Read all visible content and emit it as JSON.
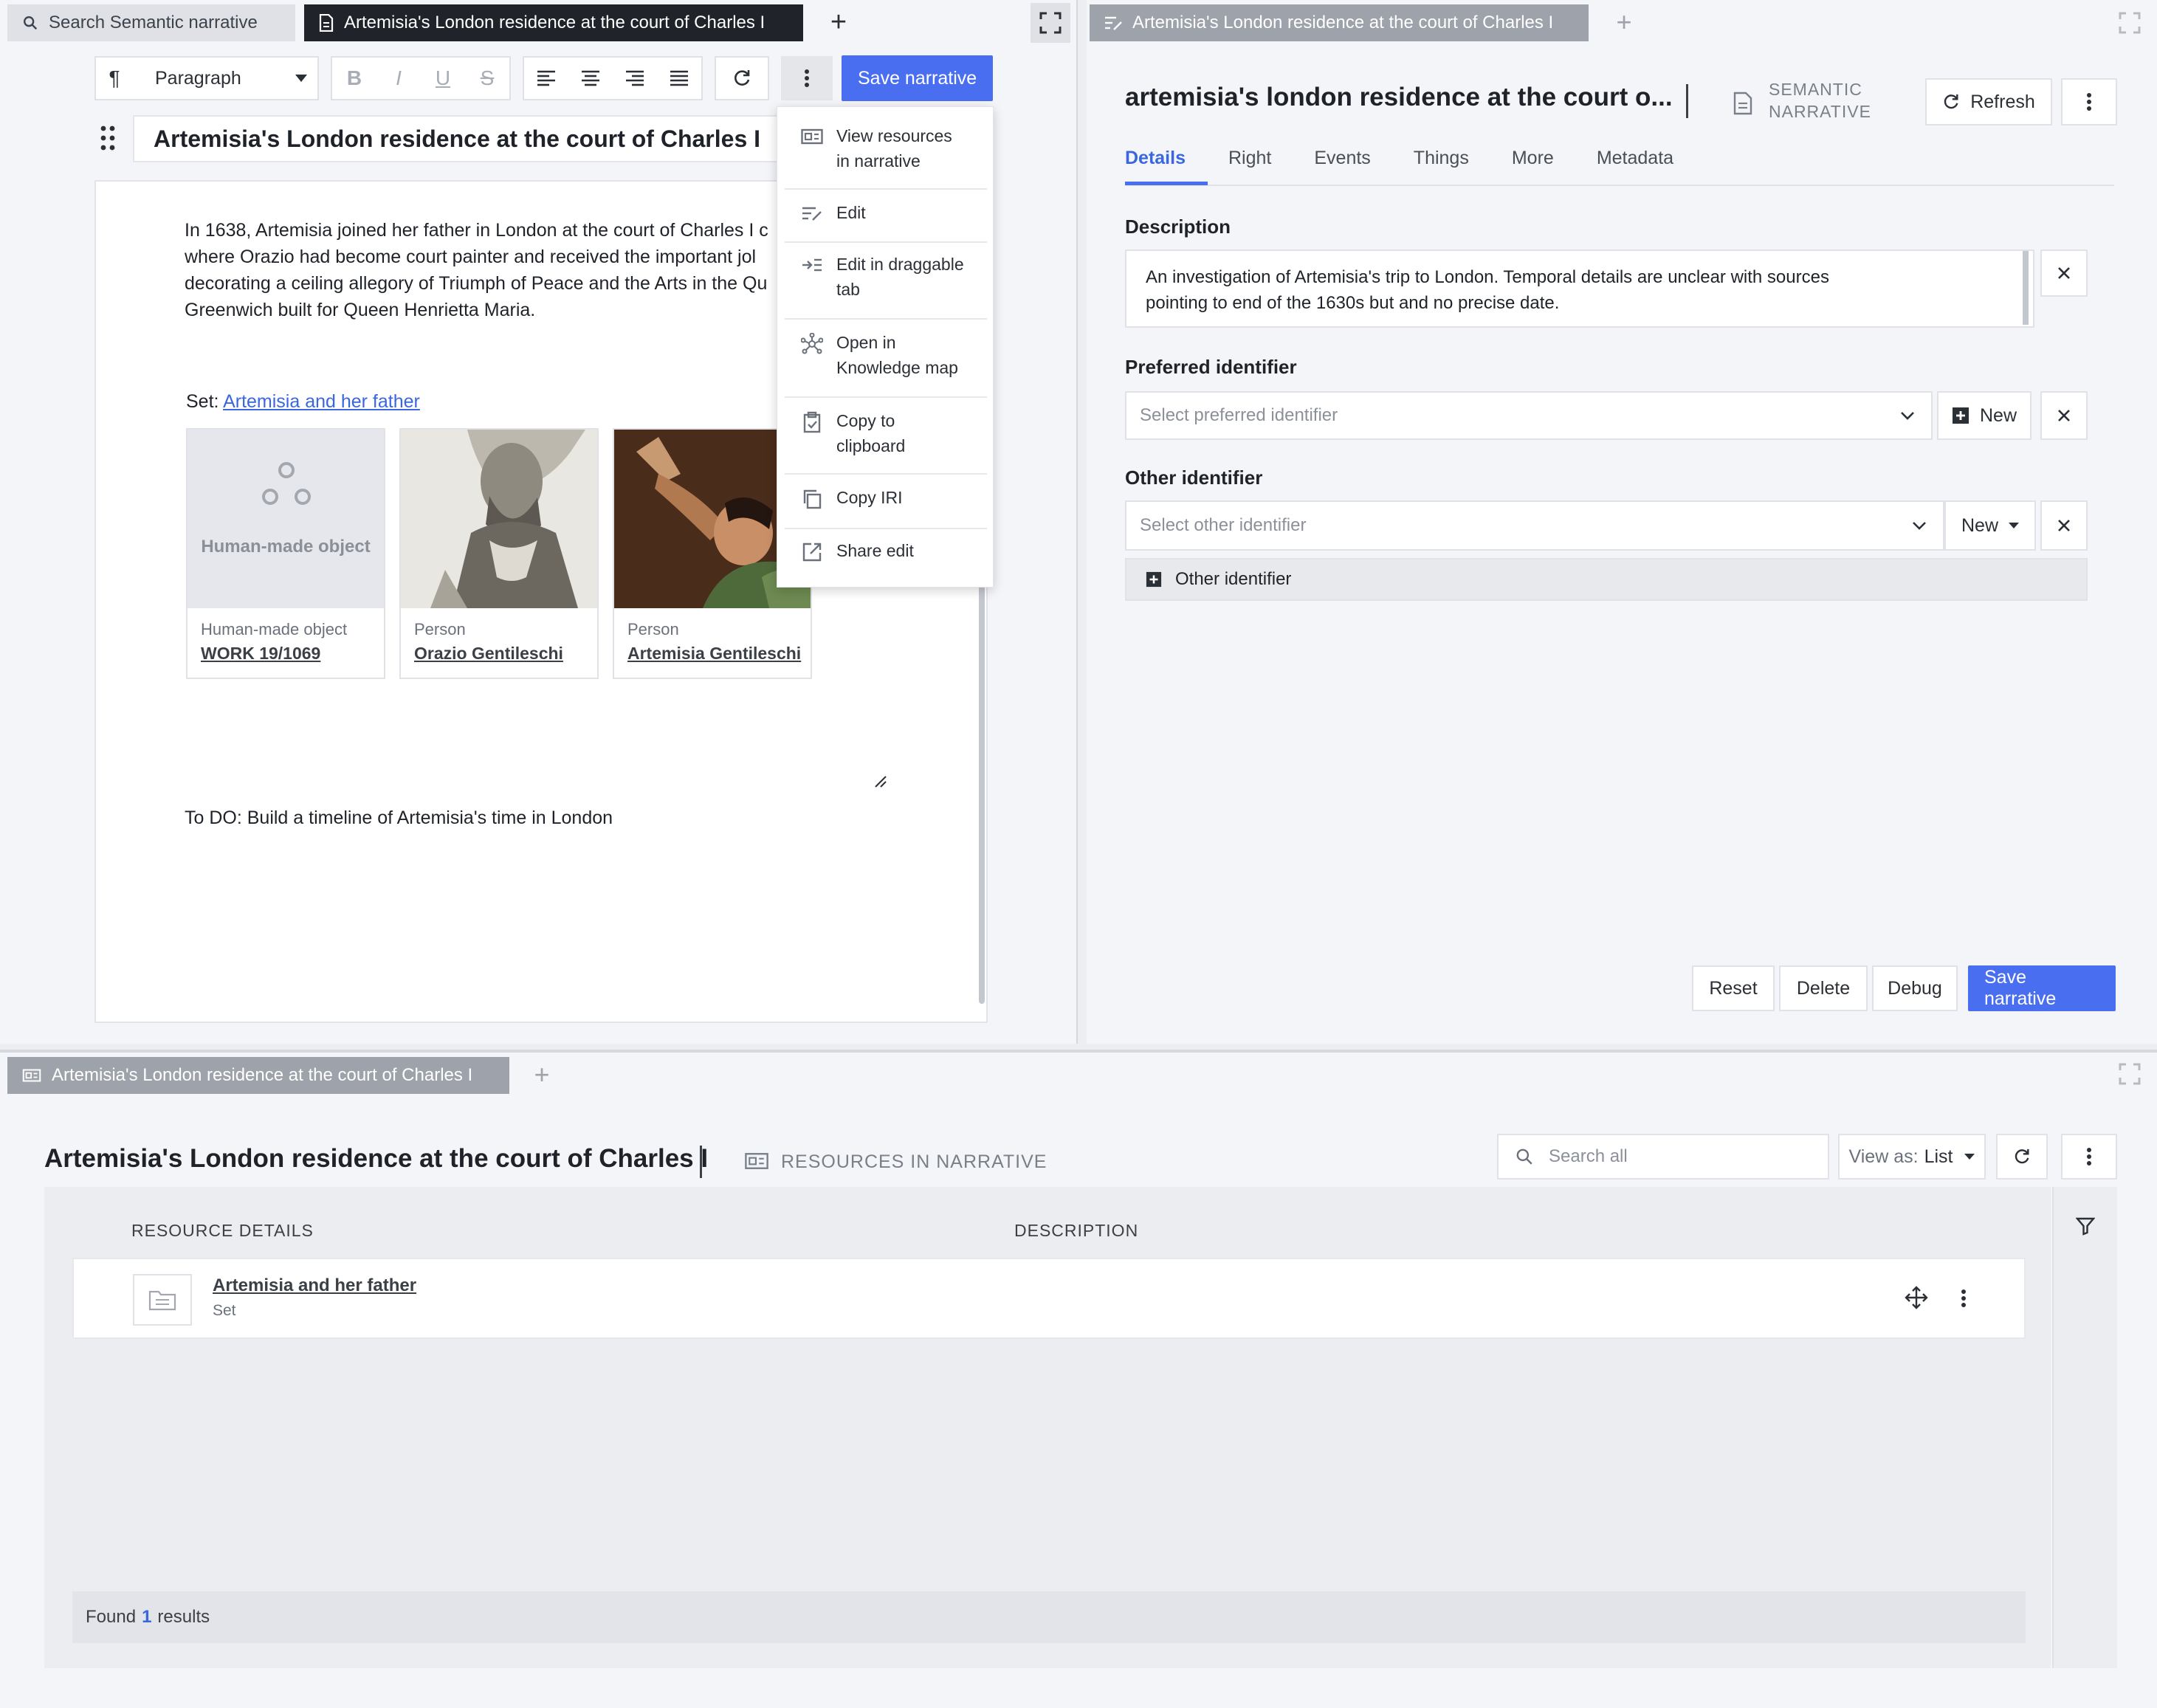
{
  "left_panel": {
    "tabs": [
      {
        "label": "Search Semantic narrative"
      },
      {
        "label": "Artemisia's London residence at the court of Charles I"
      }
    ],
    "add_tab": "+",
    "toolbar": {
      "paragraph_mark": "¶",
      "block_type": "Paragraph",
      "bold": "B",
      "italic": "I",
      "underline": "U",
      "strike": "S",
      "save_label": "Save narrative"
    },
    "title": "Artemisia's London residence at the court of Charles I",
    "body_paragraph": {
      "line1": "In 1638, Artemisia joined her father in London at the court of Charles I c",
      "line2": "where Orazio had become court painter and received the important jol",
      "line3": "decorating a ceiling allegory of Triumph of Peace and the Arts in the Qu",
      "line4": "Greenwich built for Queen Henrietta Maria."
    },
    "set_prefix": "Set:",
    "set_link": "Artemisia and her father",
    "cards": [
      {
        "placeholder": "Human-made object",
        "type": "Human-made object",
        "link": "WORK 19/1069"
      },
      {
        "type": "Person",
        "link": "Orazio Gentileschi"
      },
      {
        "type": "Person",
        "link": "Artemisia Gentileschi"
      }
    ],
    "todo": "To DO: Build a timeline of Artemisia's time in London",
    "menu": [
      {
        "label1": "View resources",
        "label2": "in narrative",
        "icon": "resources-icon"
      },
      {
        "label1": "Edit",
        "label2": "",
        "icon": "edit-icon"
      },
      {
        "label1": "Edit in draggable",
        "label2": "tab",
        "icon": "draggable-edit-icon"
      },
      {
        "label1": "Open in",
        "label2": "Knowledge map",
        "icon": "knowledge-map-icon"
      },
      {
        "label1": "Copy to",
        "label2": "clipboard",
        "icon": "clipboard-icon"
      },
      {
        "label1": "Copy IRI",
        "label2": "",
        "icon": "copy-icon"
      },
      {
        "label1": "Share edit",
        "label2": "",
        "icon": "share-icon"
      }
    ]
  },
  "right_panel": {
    "tab": "Artemisia's London residence at the court of Charles I",
    "title": "artemisia's london residence at the court o...",
    "type_badge_line1": "SEMANTIC",
    "type_badge_line2": "NARRATIVE",
    "refresh": "Refresh",
    "subtabs": [
      "Details",
      "Right",
      "Events",
      "Things",
      "More",
      "Metadata"
    ],
    "description_label": "Description",
    "description_line1": "An investigation of Artemisia's trip to London. Temporal details are unclear with sources",
    "description_line2": "pointing to end of the 1630s but and no precise date.",
    "preferred_label": "Preferred identifier",
    "preferred_placeholder": "Select preferred identifier",
    "new_label": "New",
    "other_label": "Other identifier",
    "other_placeholder": "Select other identifier",
    "other_new": "New",
    "other_add": "Other identifier",
    "buttons": {
      "reset": "Reset",
      "delete": "Delete",
      "debug": "Debug",
      "save": "Save narrative"
    }
  },
  "bottom_panel": {
    "tab": "Artemisia's London residence at the court of Charles I",
    "title": "Artemisia's London residence at the court of Charles I",
    "subtitle": "RESOURCES IN NARRATIVE",
    "search_placeholder": "Search all",
    "view_as_prefix": "View as:",
    "view_as_value": "List",
    "columns": [
      "RESOURCE DETAILS",
      "DESCRIPTION"
    ],
    "rows": [
      {
        "title": "Artemisia and her father",
        "type": "Set"
      }
    ],
    "found_prefix": "Found",
    "found_count": "1",
    "found_suffix": "results"
  },
  "colors": {
    "accent": "#4a6ef0",
    "link": "#3a67e0",
    "dark_tab": "#20232a"
  }
}
